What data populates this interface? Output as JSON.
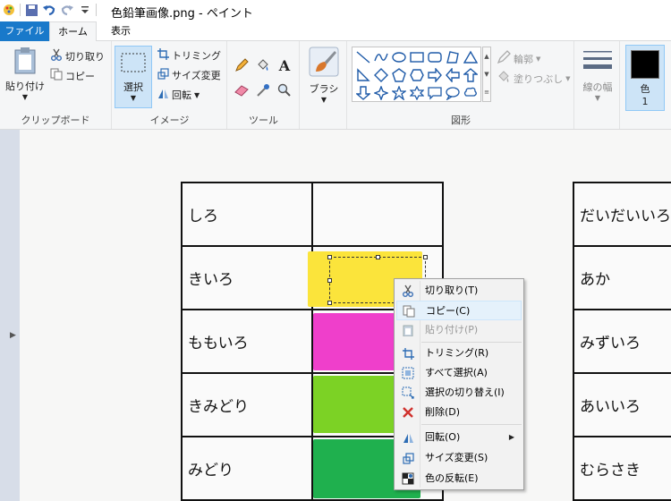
{
  "window": {
    "title": "色鉛筆画像.png - ペイント"
  },
  "tabs": {
    "file": "ファイル",
    "home": "ホーム",
    "view": "表示"
  },
  "clipboard": {
    "paste": "貼り付け",
    "cut": "切り取り",
    "copy": "コピー",
    "label": "クリップボード"
  },
  "image": {
    "select": "選択",
    "crop": "トリミング",
    "resize": "サイズ変更",
    "rotate": "回転",
    "label": "イメージ"
  },
  "tools": {
    "label": "ツール"
  },
  "brushes": {
    "label": "ブラシ"
  },
  "shapes": {
    "outline": "輪郭",
    "fill": "塗りつぶし",
    "label": "図形"
  },
  "size": {
    "label": "線の幅"
  },
  "color": {
    "label": "色",
    "index": "1",
    "value": "#000000"
  },
  "table_left": {
    "rows": [
      {
        "name": "しろ",
        "color": "#ffffff"
      },
      {
        "name": "きいろ",
        "color": "#fbe43b"
      },
      {
        "name": "ももいろ",
        "color": "#ef3fcb"
      },
      {
        "name": "きみどり",
        "color": "#7cd225"
      },
      {
        "name": "みどり",
        "color": "#1fb04e"
      }
    ]
  },
  "table_right": {
    "rows": [
      "だいだいいろ",
      "あか",
      "みずいろ",
      "あいいろ",
      "むらさき"
    ]
  },
  "context_menu": {
    "items": [
      {
        "label": "切り取り(T)",
        "icon": "scissors-icon",
        "disabled": false,
        "highlighted": false
      },
      {
        "label": "コピー(C)",
        "icon": "copy-icon",
        "disabled": false,
        "highlighted": true
      },
      {
        "label": "貼り付け(P)",
        "icon": "paste-icon",
        "disabled": true,
        "highlighted": false
      },
      {
        "label": "トリミング(R)",
        "icon": "crop-icon",
        "disabled": false,
        "highlighted": false
      },
      {
        "label": "すべて選択(A)",
        "icon": "select-all-icon",
        "disabled": false,
        "highlighted": false
      },
      {
        "label": "選択の切り替え(I)",
        "icon": "invert-selection-icon",
        "disabled": false,
        "highlighted": false
      },
      {
        "label": "削除(D)",
        "icon": "delete-icon",
        "disabled": false,
        "highlighted": false
      },
      {
        "label": "回転(O)",
        "icon": "rotate-icon",
        "disabled": false,
        "highlighted": false
      },
      {
        "label": "サイズ変更(S)",
        "icon": "resize-icon",
        "disabled": false,
        "highlighted": false
      },
      {
        "label": "色の反転(E)",
        "icon": "invert-color-icon",
        "disabled": false,
        "highlighted": false
      }
    ]
  }
}
